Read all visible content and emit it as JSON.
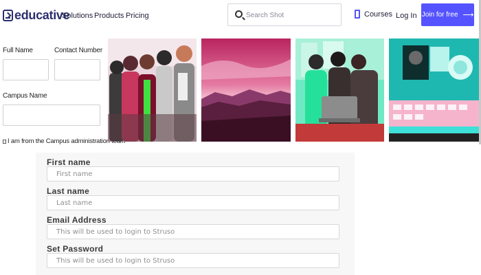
{
  "nav": {
    "logo_text": "educative",
    "links": [
      "Solutions",
      "Products",
      "Pricing"
    ],
    "search_placeholder": "Search Shot",
    "courses_label": "Courses",
    "login_label": "Log In",
    "join_label": "Join for free",
    "join_arrow": "⟶"
  },
  "campus_form": {
    "full_name_label": "Full Name",
    "contact_number_label": "Contact Number",
    "campus_name_label": "Campus Name",
    "admin_checkbox_label": "I am from the Campus administration team"
  },
  "signup_form": {
    "fields": [
      {
        "label": "First name",
        "placeholder": "First name"
      },
      {
        "label": "Last name",
        "placeholder": "Last name"
      },
      {
        "label": "Email Address",
        "placeholder": "This will be used to login to Struso"
      },
      {
        "label": "Set Password",
        "placeholder": "This will be used to login to Struso"
      }
    ]
  },
  "colors": {
    "brand": "#2b2f6e",
    "accent": "#5553ff",
    "photo_magenta": "#c0306a",
    "photo_cyan": "#2fe0c8"
  }
}
